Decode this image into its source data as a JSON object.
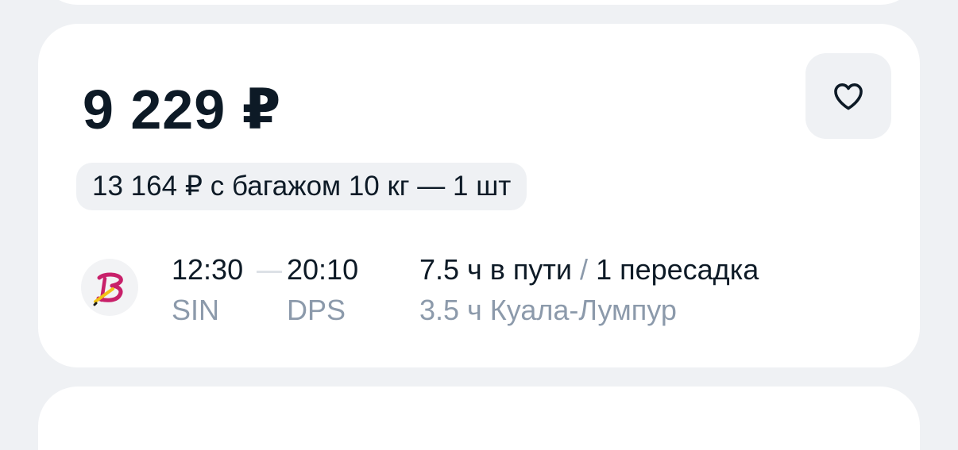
{
  "offer": {
    "price": "9 229 ₽",
    "baggage_option": "13 164 ₽ с багажом 10 кг — 1 шт",
    "departure_time": "12:30",
    "departure_airport": "SIN",
    "arrival_time": "20:10",
    "arrival_airport": "DPS",
    "duration": "7.5 ч в пути",
    "separator": "/",
    "stops": "1 пересадка",
    "layover": "3.5 ч Куала-Лумпур"
  },
  "icons": {
    "favorite": "heart-outline-icon",
    "airline": "airline-logo-icon"
  },
  "colors": {
    "background": "#eff1f4",
    "card": "#ffffff",
    "text": "#0d1a26",
    "muted": "#8c9aab",
    "airline_logo_primary": "#c8206a",
    "airline_logo_accent": "#f2c316"
  }
}
